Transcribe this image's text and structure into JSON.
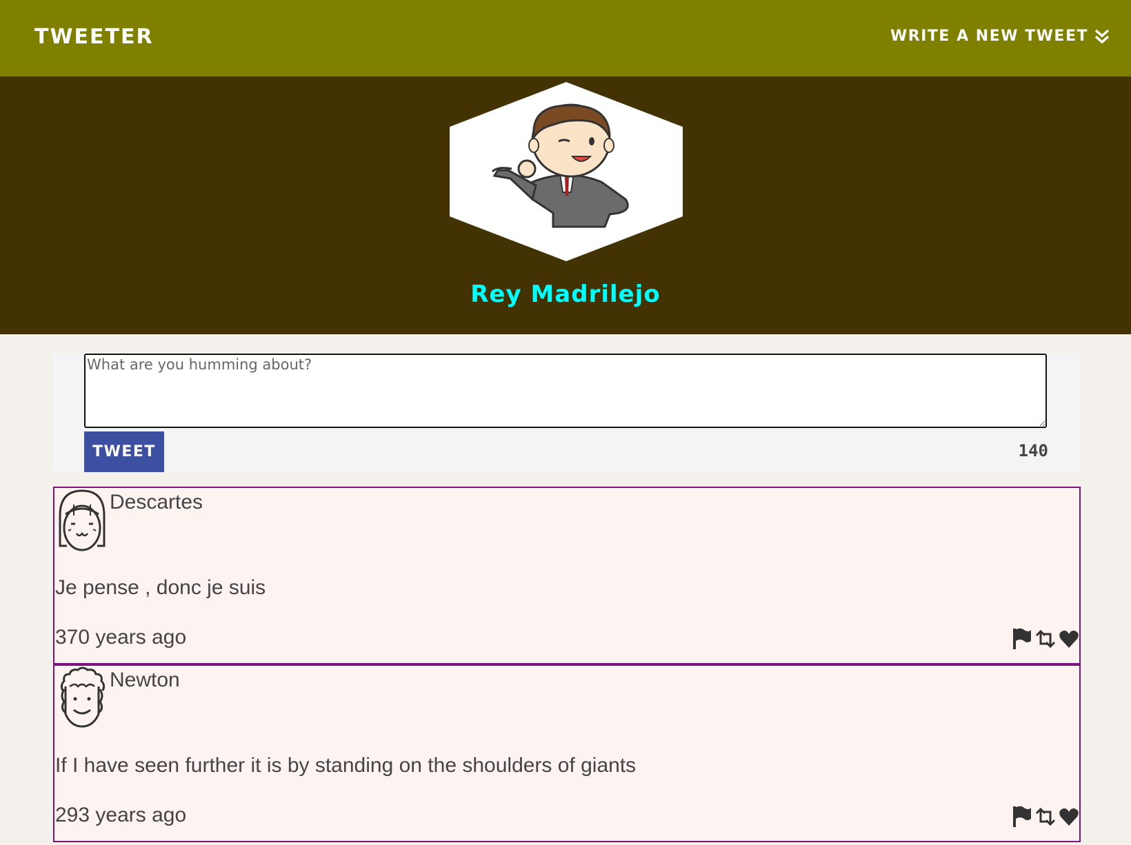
{
  "nav": {
    "brand": "Tweeter",
    "compose_label": "Write a new tweet",
    "compose_icon": "double-chevron-down-icon"
  },
  "profile": {
    "name": "Rey Madrilejo",
    "avatar_icon": "cartoon-businessman-avatar"
  },
  "composer": {
    "placeholder": "What are you humming about?",
    "value": "",
    "button_label": "Tweet",
    "counter": "140"
  },
  "tweets": [
    {
      "author": "Descartes",
      "avatar_icon": "girl-face-avatar",
      "content": "Je pense , donc je suis",
      "time": "370 years ago",
      "actions": [
        "flag-icon",
        "retweet-icon",
        "heart-icon"
      ]
    },
    {
      "author": "Newton",
      "avatar_icon": "curly-hair-face-avatar",
      "content": "If I have seen further it is by standing on the shoulders of giants",
      "time": "293 years ago",
      "actions": [
        "flag-icon",
        "retweet-icon",
        "heart-icon"
      ]
    }
  ],
  "colors": {
    "nav_bg": "#7f7f00",
    "hero_bg": "#433304",
    "name_color": "#00ffff",
    "button_bg": "#3d4fa0",
    "tweet_border": "#7d117d",
    "tweet_bg": "#fdf3f0"
  }
}
